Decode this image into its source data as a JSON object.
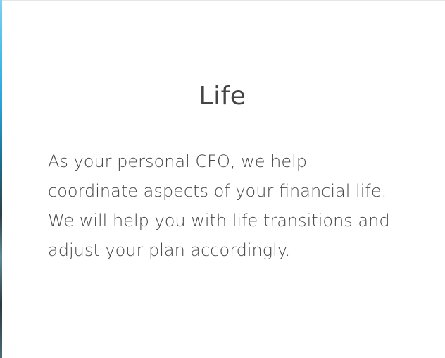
{
  "card": {
    "title": "Life",
    "body": "As your personal CFO, we help coordinate aspects of your financial life. We will help you with life transitions and adjust your plan accordingly."
  },
  "colors": {
    "background": "#ffffff",
    "title_text": "#444444",
    "body_text": "#4a4a4a",
    "left_accent": "#2a9fd6"
  }
}
